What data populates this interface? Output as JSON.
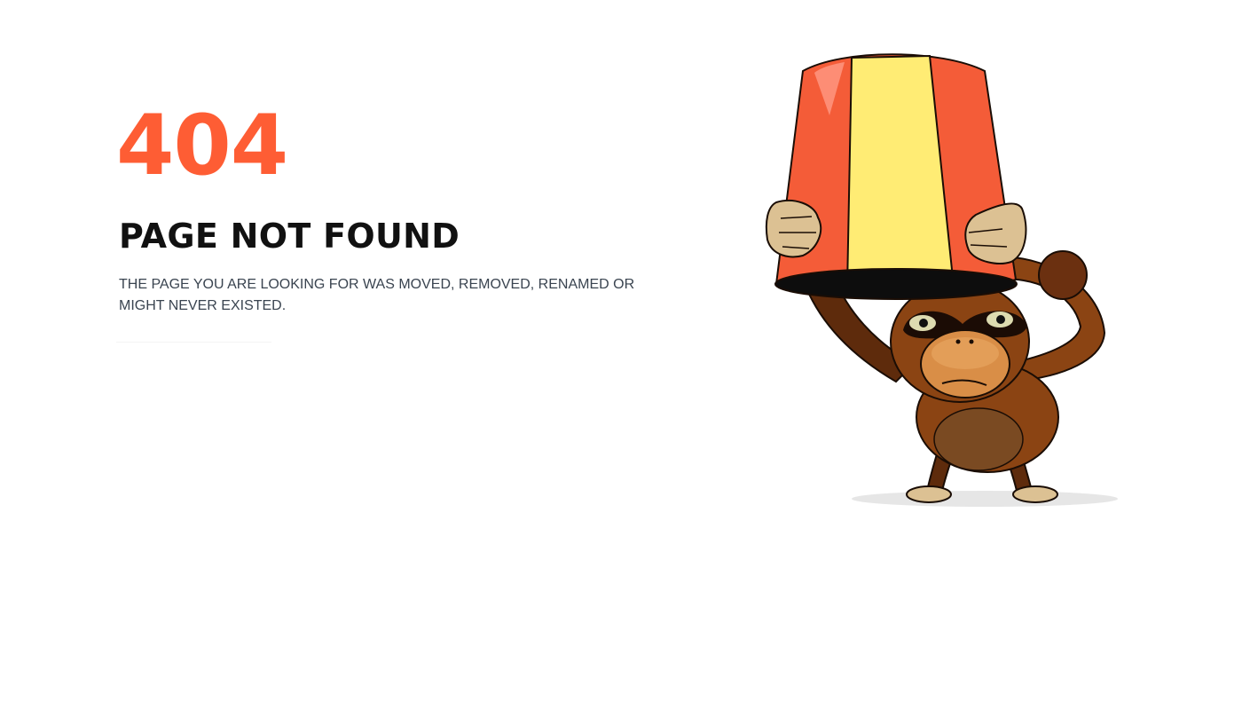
{
  "error": {
    "code": "404",
    "title": "PAGE NOT FOUND",
    "message": "THE PAGE YOU ARE LOOKING FOR WAS MOVED, REMOVED, RENAMED OR MIGHT NEVER EXISTED."
  },
  "illustration": {
    "icon": "monkey-with-bucket-icon"
  },
  "colors": {
    "accent": "#fe5d34",
    "title": "#111111",
    "message": "#3a4450",
    "bucket_red": "#f45c38",
    "bucket_yellow": "#ffec74",
    "fur": "#8b4413",
    "fur_dark": "#5e2b0c",
    "face": "#d98e47",
    "hand": "#dcc193"
  }
}
